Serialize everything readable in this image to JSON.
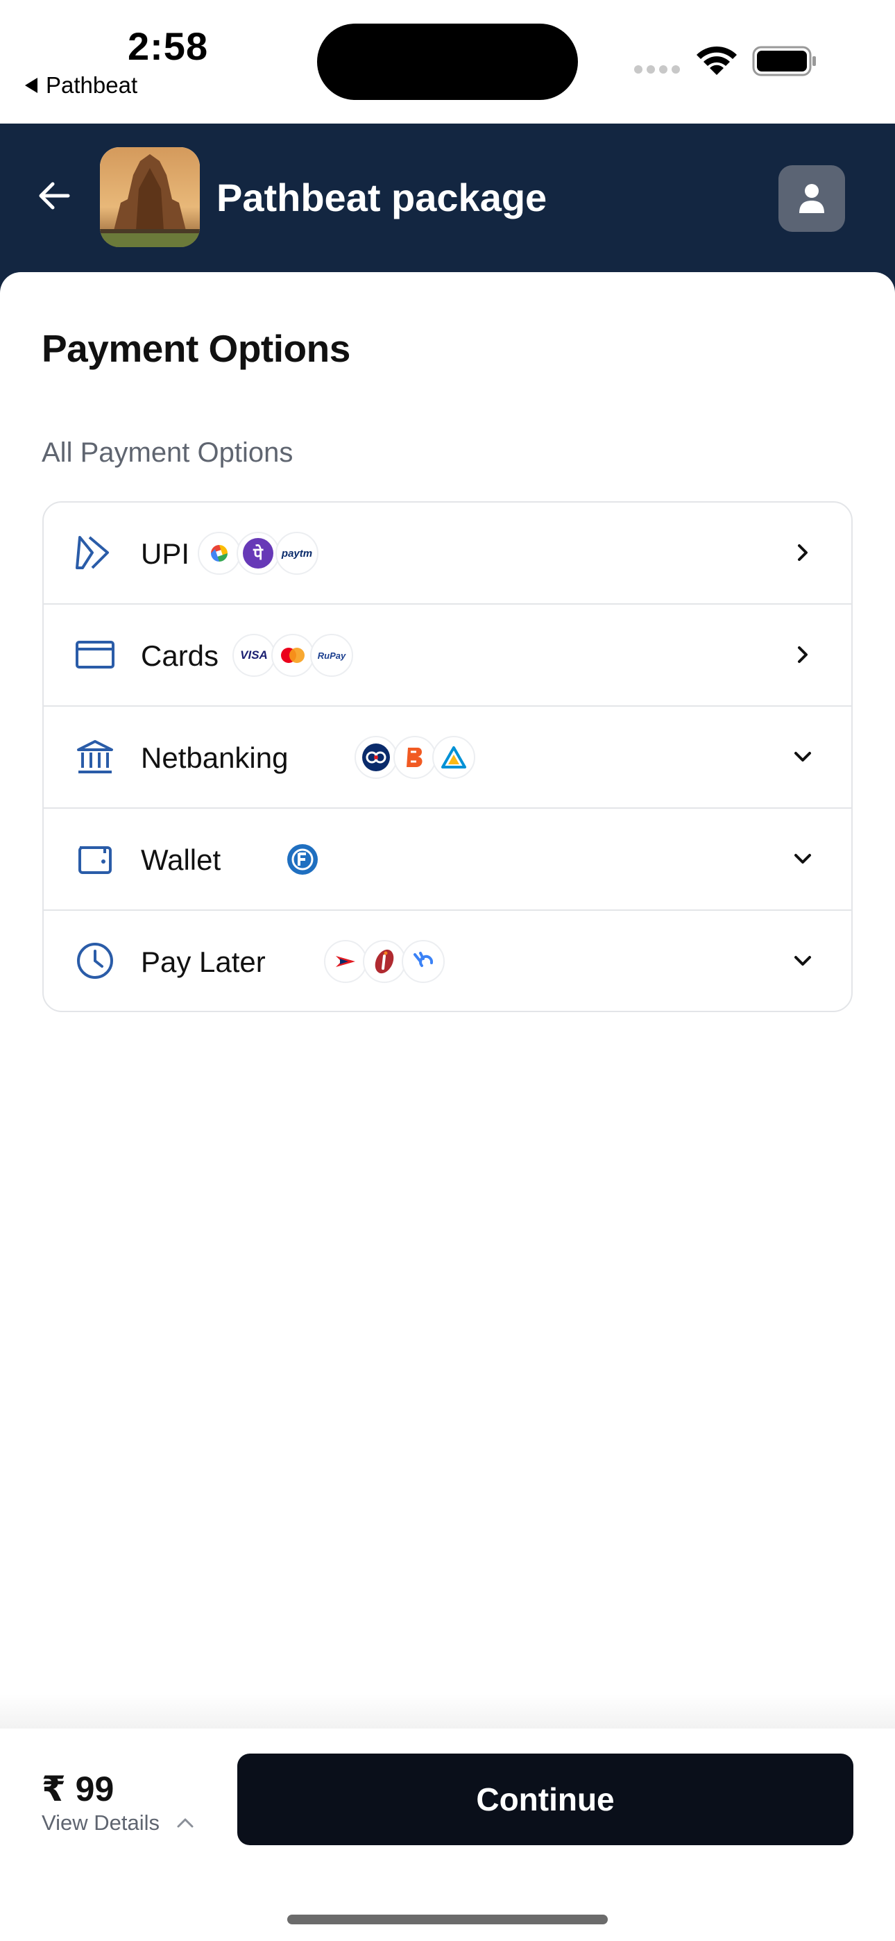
{
  "status_bar": {
    "time": "2:58",
    "back_app": "Pathbeat"
  },
  "header": {
    "title": "Pathbeat package"
  },
  "page": {
    "title": "Payment Options",
    "section_label": "All Payment Options"
  },
  "payment_options": [
    {
      "label": "UPI",
      "icon": "upi-icon",
      "chevron": "right",
      "badges": [
        "google-pay-logo",
        "phonepe-logo",
        "paytm-logo"
      ],
      "badge_text": [
        "",
        "पे",
        "paytm"
      ]
    },
    {
      "label": "Cards",
      "icon": "card-icon",
      "chevron": "right",
      "badges": [
        "visa-logo",
        "mastercard-logo",
        "rupay-logo"
      ],
      "badge_text": [
        "VISA",
        "",
        "RuPay"
      ]
    },
    {
      "label": "Netbanking",
      "icon": "bank-icon",
      "chevron": "down",
      "badges": [
        "kotak-logo",
        "bank-of-baroda-logo",
        "canara-bank-logo"
      ],
      "badge_text": [
        "",
        "",
        ""
      ]
    },
    {
      "label": "Wallet",
      "icon": "wallet-icon",
      "chevron": "down",
      "badges": [
        "freecharge-logo"
      ],
      "badge_text": [
        ""
      ]
    },
    {
      "label": "Pay Later",
      "icon": "clock-icon",
      "chevron": "down",
      "badges": [
        "hdfc-logo",
        "icici-logo",
        "paylater-logo"
      ],
      "badge_text": [
        "",
        "",
        ""
      ]
    }
  ],
  "footer": {
    "price": "₹ 99",
    "view_details": "View Details",
    "continue_label": "Continue"
  },
  "colors": {
    "header_bg": "#132641",
    "accent_blue": "#2a5ca8",
    "button_bg": "#0a0f1a"
  }
}
